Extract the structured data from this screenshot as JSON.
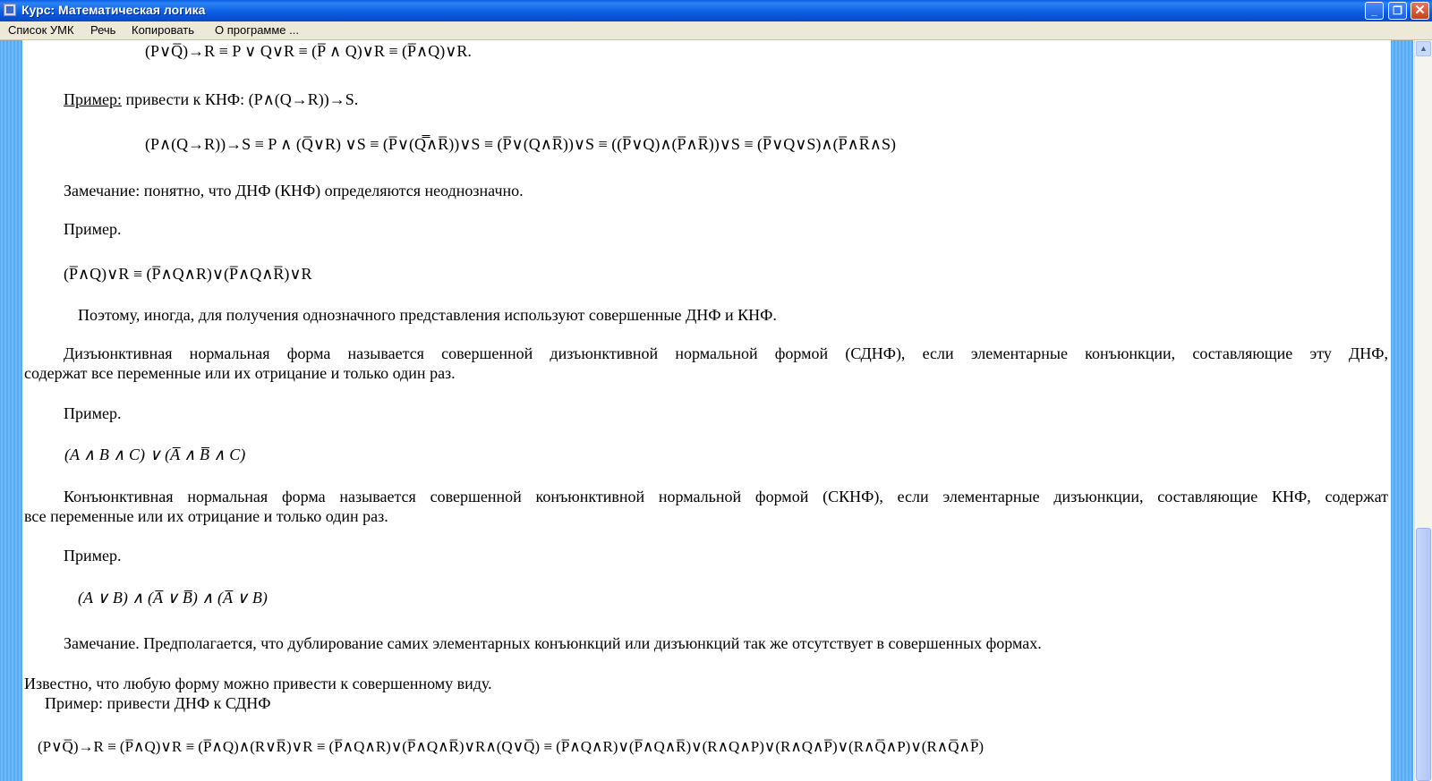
{
  "window": {
    "title": "Курс: Математическая логика",
    "minimize": "_",
    "maximize": "❐",
    "close": "✕"
  },
  "menu": [
    "Список УМК",
    "Речь",
    "Копировать",
    "О программе ..."
  ],
  "content": {
    "formula_top": "(P∨Q̅)→R ≡ P ∨ Q∨R ≡ (P̅ ∧ Q)∨R ≡ (P̅∧Q)∨R.",
    "example_underline": "Пример:",
    "example_knf_text": " привести к КНФ: (P∧(Q→R))→S.",
    "formula_knf": "(P∧(Q→R))→S ≡ P ∧ (Q̅∨R) ∨S ≡ (P̅∨(Q̿∧R̅))∨S ≡ (P̅∨(Q∧R̅))∨S ≡ ((P̅∨Q)∧(P̅∧R̅))∨S ≡ (P̅∨Q∨S)∧(P̅∧R̅∧S)",
    "remark1": "Замечание: понятно, что ДНФ (КНФ) определяются неоднозначно.",
    "example1": "Пример.",
    "formula_ex1": "(P̅∧Q)∨R ≡ (P̅∧Q∧R)∨(P̅∧Q∧R̅)∨R",
    "therefore": "Поэтому, иногда, для получения однозначного представления используют совершенные ДНФ и КНФ.",
    "sdnf_def_line1": "Дизъюнктивная нормальная форма называется совершенной дизъюнктивной нормальной формой (СДНФ), если элементарные конъюнкции, составляющие эту ДНФ,",
    "sdnf_def_line2": "содержат все переменные или их отрицание и только один раз.",
    "example2": "Пример.",
    "formula_ex2": "(A ∧ B ∧ C) ∨ (A̅ ∧ B̅ ∧ C)",
    "sknf_def_line1": "Конъюнктивная нормальная форма называется совершенной конъюнктивной нормальной формой (СКНФ), если элементарные дизъюнкции, составляющие КНФ, содержат",
    "sknf_def_line2": "все переменные или их отрицание и только один раз.",
    "example3": "Пример.",
    "formula_ex3": "(A ∨ B) ∧ (A̅ ∨ B̅) ∧ (A̅ ∨ B)",
    "remark2": "Замечание. Предполагается, что дублирование самих элементарных конъюнкций или дизъюнкций так же отсутствует в совершенных формах.",
    "known": "Известно, что любую форму можно привести к совершенному виду.",
    "example4": "Пример: привести ДНФ к СДНФ",
    "formula_bottom": "(P∨Q̅)→R ≡ (P̅∧Q)∨R ≡ (P̅∧Q)∧(R∨R̅)∨R ≡ (P̅∧Q∧R)∨(P̅∧Q∧R̅)∨R∧(Q∨Q̅) ≡ (P̅∧Q∧R)∨(P̅∧Q∧R̅)∨(R∧Q∧P)∨(R∧Q∧P̅)∨(R∧Q̅∧P)∨(R∧Q̅∧P̅)"
  },
  "colors": {
    "titlebar": "#0a5ce0",
    "menubar": "#ece9d8",
    "stripe": "#4aa2f0",
    "background": "#ffffff"
  }
}
